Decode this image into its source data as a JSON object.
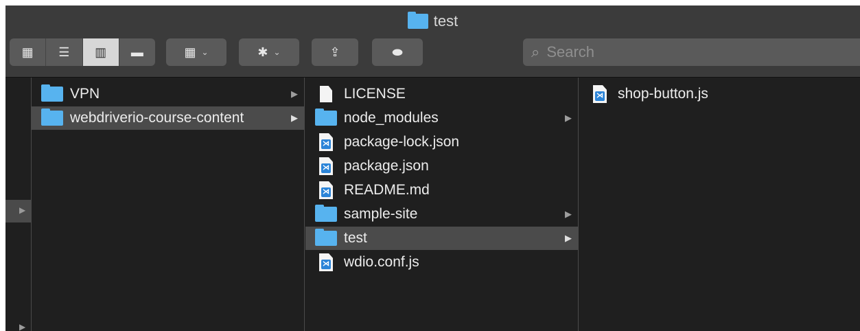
{
  "window": {
    "title": "test"
  },
  "toolbar": {
    "view_modes": [
      {
        "icon": "icon-view-icon",
        "glyph": "▦",
        "active": false
      },
      {
        "icon": "list-view-icon",
        "glyph": "☰",
        "active": false
      },
      {
        "icon": "column-view-icon",
        "glyph": "▥",
        "active": true
      },
      {
        "icon": "gallery-view-icon",
        "glyph": "▬",
        "active": false
      }
    ],
    "group_glyph": "▦",
    "action_glyph": "✱",
    "chevron_glyph": "⌄",
    "share_glyph": "⇪",
    "tag_glyph": "⬬"
  },
  "search": {
    "placeholder": "Search",
    "value": ""
  },
  "columns": {
    "col1": [
      {
        "name": "VPN",
        "type": "folder",
        "has_children": true,
        "selected": false
      },
      {
        "name": "webdriverio-course-content",
        "type": "folder",
        "has_children": true,
        "selected": true
      }
    ],
    "col2": [
      {
        "name": "LICENSE",
        "type": "doc",
        "has_children": false,
        "selected": false
      },
      {
        "name": "node_modules",
        "type": "folder",
        "has_children": true,
        "selected": false
      },
      {
        "name": "package-lock.json",
        "type": "vscode",
        "has_children": false,
        "selected": false
      },
      {
        "name": "package.json",
        "type": "vscode",
        "has_children": false,
        "selected": false
      },
      {
        "name": "README.md",
        "type": "vscode",
        "has_children": false,
        "selected": false
      },
      {
        "name": "sample-site",
        "type": "folder",
        "has_children": true,
        "selected": false
      },
      {
        "name": "test",
        "type": "folder",
        "has_children": true,
        "selected": true
      },
      {
        "name": "wdio.conf.js",
        "type": "vscode",
        "has_children": false,
        "selected": false
      }
    ],
    "col3": [
      {
        "name": "shop-button.js",
        "type": "vscode",
        "has_children": false,
        "selected": false
      }
    ]
  },
  "colors": {
    "folder": "#57b3ef",
    "selection": "#4b4b4b",
    "background": "#1f1f1f",
    "toolbar": "#3b3b3b",
    "vscode_blue": "#2b84d8"
  }
}
